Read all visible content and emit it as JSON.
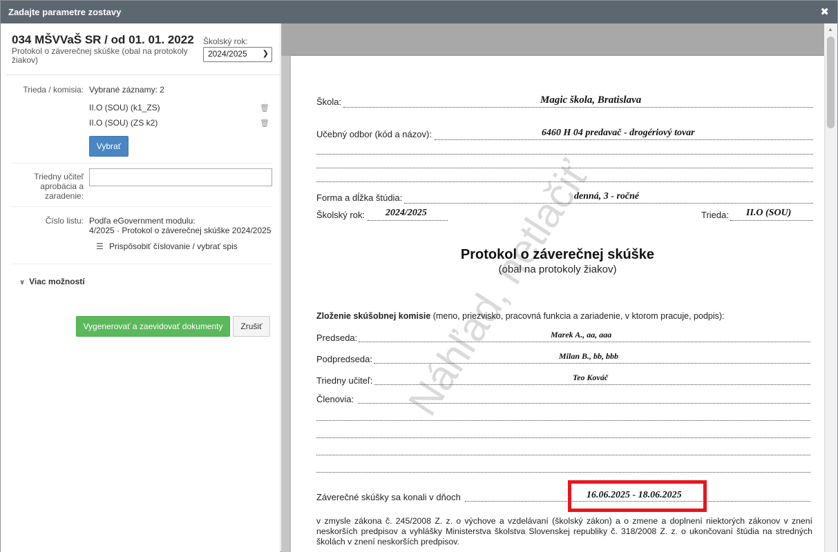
{
  "dialog": {
    "title": "Zadajte parametre zostavy",
    "close_icon": "close-icon"
  },
  "left": {
    "report_title": "034 MŠVVaŠ SR / od 01. 01. 2022",
    "report_subtitle": "Protokol o záverečnej skúške (obal na protokoly žiakov)",
    "school_year_label": "Školský rok:",
    "school_year_value": "2024/2025",
    "class_label": "Trieda / komisia:",
    "selected_records": "Vybrané záznamy: 2",
    "records": [
      "II.O (SOU) (k1_ZS)",
      "II.O (SOU) (ZS k2)"
    ],
    "select_button": "Vybrať",
    "teacher_label": "Triedny učiteľ aprobácia a zaradenie:",
    "teacher_value": "",
    "sheet_label": "Číslo listu:",
    "sheet_line1": "Podľa eGovernment modulu:",
    "sheet_line2": "4/2025 · Protokol o záverečnej skúške 2024/2025",
    "adjust_numbering": "Prispôsobiť číslovanie / vybrať spis",
    "more_options": "Viac možností",
    "generate_button": "Vygenerovať a zaevidovať dokumenty",
    "cancel_button": "Zrušiť"
  },
  "preview": {
    "school_label": "Škola:",
    "school_value": "Magic škola, Bratislava",
    "field_label": "Učebný odbor (kód a názov):",
    "field_value": "6460 H 04 predavač - drogériový tovar",
    "form_label": "Forma a dĺžka štúdia:",
    "form_value": "denná, 3 - ročné",
    "year_label": "Školský rok:",
    "year_value": "2024/2025",
    "class_label": "Trieda:",
    "class_value": "II.O (SOU)",
    "doc_title": "Protokol o záverečnej skúške",
    "doc_subtitle": "(obal na protokoly žiakov)",
    "committee_bold": "Zloženie skúšobnej komisie",
    "committee_rest": " (meno, priezvisko, pracovná funkcia a zariadenie, v ktorom pracuje, podpis):",
    "chair_label": "Predseda:",
    "chair_value": "Marek A., aa, aaa",
    "vice_label": "Podpredseda:",
    "vice_value": "Milan B., bb, bbb",
    "teacher_label": "Triedny učiteľ:",
    "teacher_value": "Teo Kováč",
    "members_label": "Členovia:",
    "exam_label": "Záverečné skúšky sa konali v dňoch",
    "exam_value": "16.06.2025 - 18.06.2025",
    "law_text": "v zmysle zákona č. 245/2008 Z. z. o výchove a vzdelávaní (školský zákon) a o zmene a doplnení niektorých zákonov v znení neskorších predpisov a vyhlášky Ministerstva školstva Slovenskej republiky č. 318/2008 Z. z. o ukončovaní štúdia na stredných školách v znení neskorších predpisov.",
    "watermark": "Náhľad, netlačiť",
    "highlight_color": "#e8161b"
  }
}
